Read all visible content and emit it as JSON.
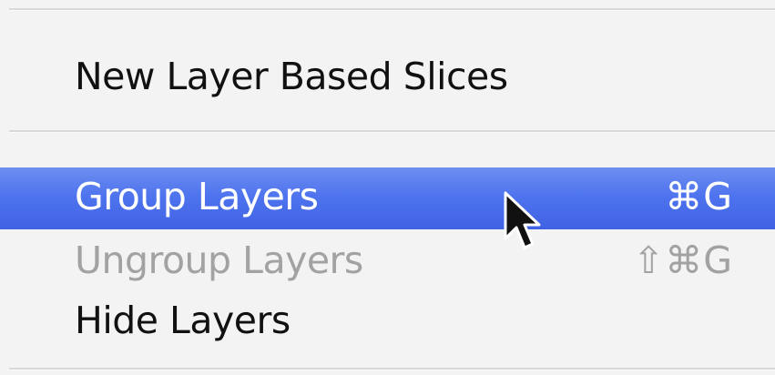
{
  "menu": {
    "items": [
      {
        "label": "New Layer Based Slices",
        "shortcut": "",
        "enabled": true,
        "highlighted": false
      },
      {
        "label": "Group Layers",
        "shortcut": "⌘G",
        "enabled": true,
        "highlighted": true
      },
      {
        "label": "Ungroup Layers",
        "shortcut": "⇧⌘G",
        "enabled": false,
        "highlighted": false
      },
      {
        "label": "Hide Layers",
        "shortcut": "",
        "enabled": true,
        "highlighted": false
      }
    ],
    "highlight_color": "#4f74ee",
    "disabled_text_color": "#a2a2a2"
  },
  "cursor": {
    "icon": "arrow-pointer-icon"
  }
}
